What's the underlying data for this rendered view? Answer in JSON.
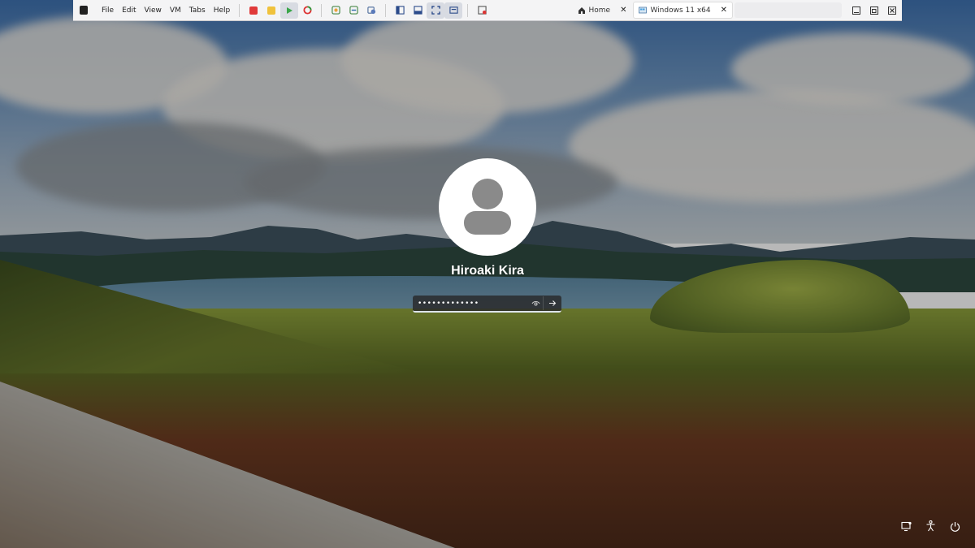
{
  "toolbar": {
    "menu": [
      {
        "label": "File"
      },
      {
        "label": "Edit"
      },
      {
        "label": "View"
      },
      {
        "label": "VM"
      },
      {
        "label": "Tabs"
      },
      {
        "label": "Help"
      }
    ],
    "tabs": [
      {
        "label": "Home",
        "icon": "home-icon"
      },
      {
        "label": "Windows 11 x64",
        "icon": "vm-icon"
      }
    ]
  },
  "login": {
    "username": "Hiroaki Kira",
    "password_mask": "•••••••••••••"
  },
  "system_icons": [
    "network-icon",
    "accessibility-icon",
    "power-icon"
  ],
  "colors": {
    "toolbar_bg": "#f4f4f5",
    "avatar_bg": "#ffffff",
    "avatar_fg": "#8a8a8a",
    "password_box": "#28282a",
    "text": "#ffffff"
  }
}
